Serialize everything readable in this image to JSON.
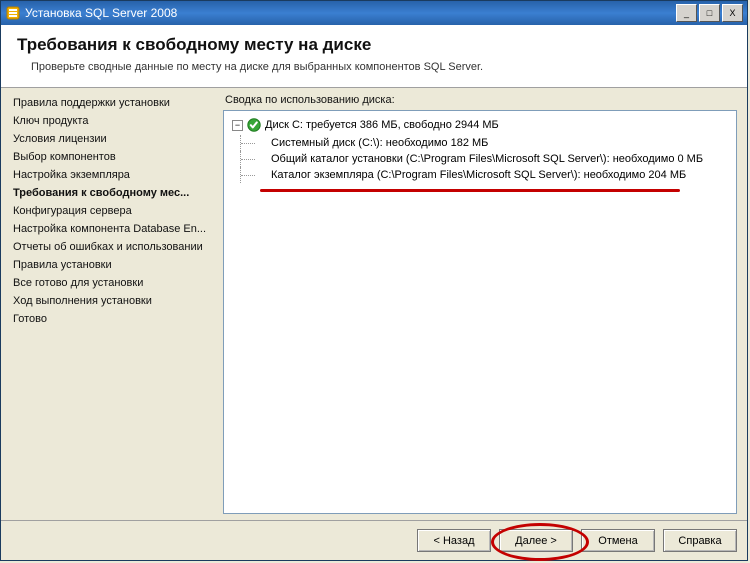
{
  "window": {
    "title": "Установка SQL Server 2008"
  },
  "banner": {
    "heading": "Требования к свободному месту на диске",
    "subtitle": "Проверьте сводные данные по месту на диске для выбранных компонентов SQL Server."
  },
  "sidebar": {
    "items": [
      {
        "label": "Правила поддержки установки",
        "current": false
      },
      {
        "label": "Ключ продукта",
        "current": false
      },
      {
        "label": "Условия лицензии",
        "current": false
      },
      {
        "label": "Выбор компонентов",
        "current": false
      },
      {
        "label": "Настройка экземпляра",
        "current": false
      },
      {
        "label": "Требования к свободному мес...",
        "current": true
      },
      {
        "label": "Конфигурация сервера",
        "current": false
      },
      {
        "label": "Настройка компонента Database En...",
        "current": false
      },
      {
        "label": "Отчеты об ошибках и использовании",
        "current": false
      },
      {
        "label": "Правила установки",
        "current": false
      },
      {
        "label": "Все готово для установки",
        "current": false
      },
      {
        "label": "Ход выполнения установки",
        "current": false
      },
      {
        "label": "Готово",
        "current": false
      }
    ]
  },
  "main": {
    "summary_label": "Сводка по использованию диска:",
    "root_label": "Диск C: требуется 386 МБ, свободно 2944 МБ",
    "children": [
      "Системный диск (C:\\): необходимо 182 МБ",
      "Общий каталог установки (C:\\Program Files\\Microsoft SQL Server\\): необходимо 0 МБ",
      "Каталог экземпляра (C:\\Program Files\\Microsoft SQL Server\\): необходимо 204 МБ"
    ]
  },
  "footer": {
    "back": "< Назад",
    "next": "Далее >",
    "cancel": "Отмена",
    "help": "Справка"
  },
  "win_controls": {
    "minimize": "_",
    "maximize": "□",
    "close": "X"
  }
}
